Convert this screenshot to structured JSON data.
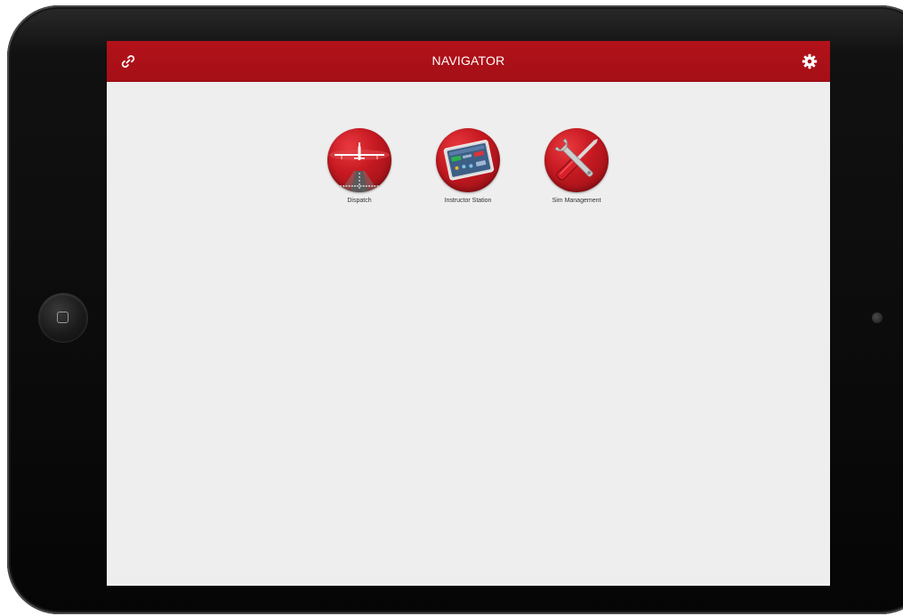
{
  "header": {
    "title": "NAVIGATOR",
    "link_icon": "link-icon",
    "settings_icon": "gear-icon"
  },
  "apps": [
    {
      "label": "Dispatch",
      "icon": "airplane-runway-icon"
    },
    {
      "label": "Instructor Station",
      "icon": "tablet-dashboard-icon"
    },
    {
      "label": "Sim Management",
      "icon": "wrench-screwdriver-icon"
    }
  ],
  "colors": {
    "accent": "#b3121a",
    "background": "#eeeeee"
  }
}
